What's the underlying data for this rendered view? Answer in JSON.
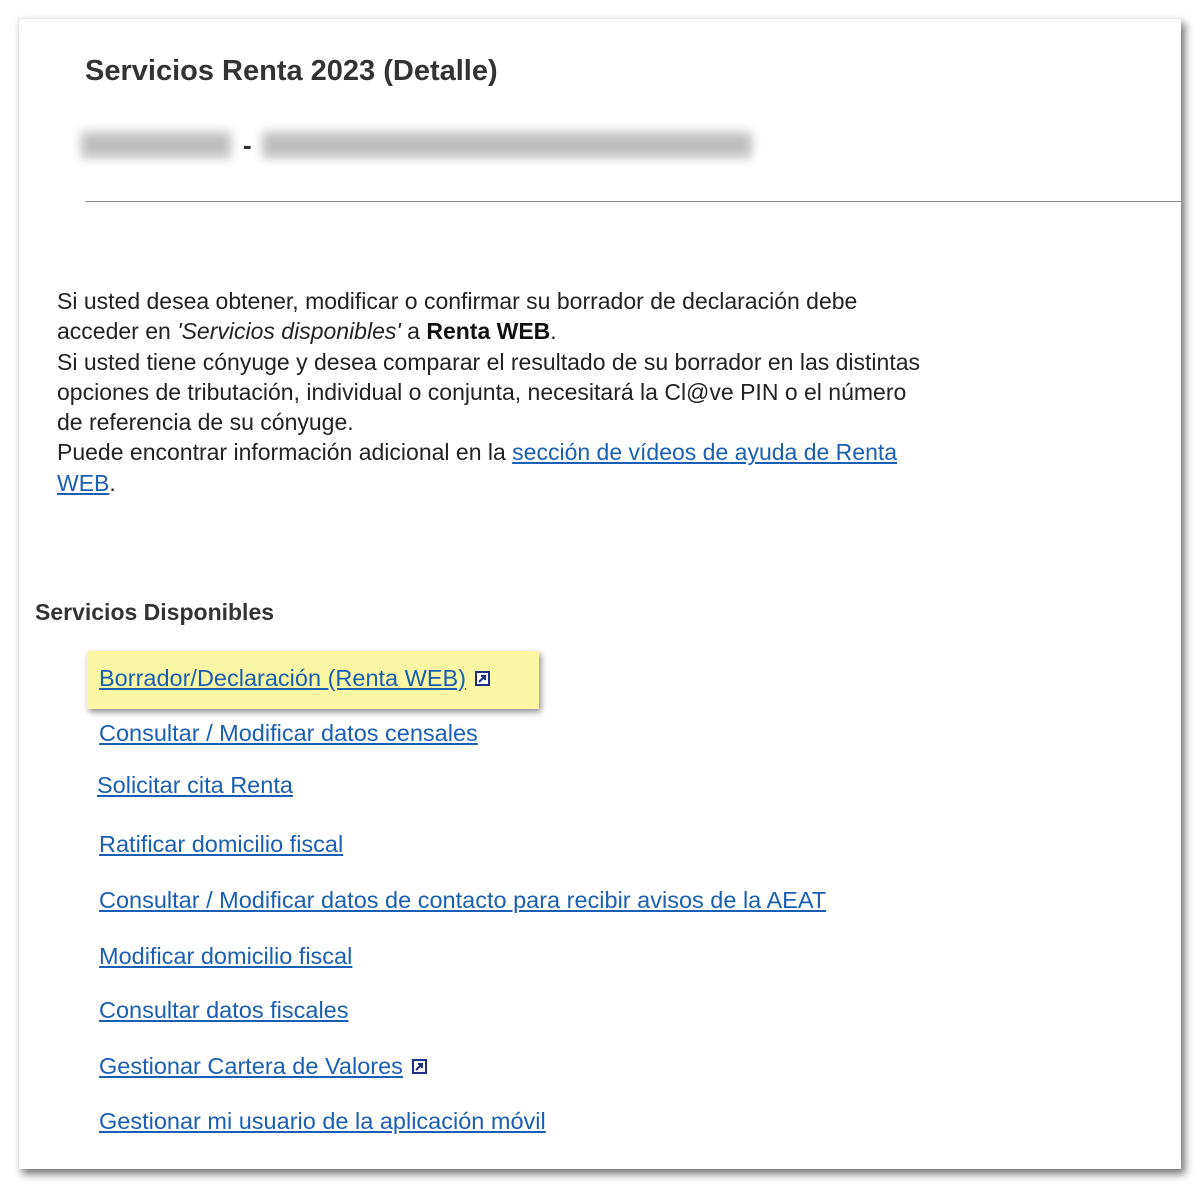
{
  "header": {
    "title": "Servicios Renta 2023 (Detalle)",
    "separator": "-"
  },
  "intro": {
    "line1": "Si usted desea obtener, modificar o confirmar su borrador de declaración debe acceder en ",
    "services_italic": "'Servicios disponibles'",
    "connector": " a ",
    "renta_web_bold": "Renta WEB",
    "period1": ".",
    "line2": "Si usted tiene cónyuge y desea comparar el resultado de su borrador en las distintas opciones de tributación, individual o conjunta, necesitará la Cl@ve PIN o el número de referencia de su cónyuge.",
    "line3_prefix": "Puede encontrar información adicional en la ",
    "videos_link": "sección de vídeos de ayuda de Renta WEB",
    "period2": "."
  },
  "services": {
    "section_title": "Servicios Disponibles",
    "items": [
      {
        "label": "Borrador/Declaración (Renta WEB)",
        "external": true,
        "highlighted": true
      },
      {
        "label": "Consultar / Modificar datos censales",
        "external": false
      },
      {
        "label": "Solicitar cita Renta",
        "external": false
      },
      {
        "label": "Ratificar domicilio fiscal",
        "external": false
      },
      {
        "label": "Consultar / Modificar datos de contacto para recibir avisos de la AEAT",
        "external": false
      },
      {
        "label": "Modificar domicilio fiscal",
        "external": false
      },
      {
        "label": "Consultar datos fiscales",
        "external": false
      },
      {
        "label": "Gestionar Cartera de Valores",
        "external": true
      },
      {
        "label": "Gestionar mi usuario de la aplicación móvil",
        "external": false
      }
    ]
  },
  "colors": {
    "link": "#1a5fb4",
    "highlight": "#f9f7a3",
    "external_icon": "#1d2d8a",
    "heading": "#333333"
  },
  "icons": {
    "external": "external-link-icon"
  }
}
